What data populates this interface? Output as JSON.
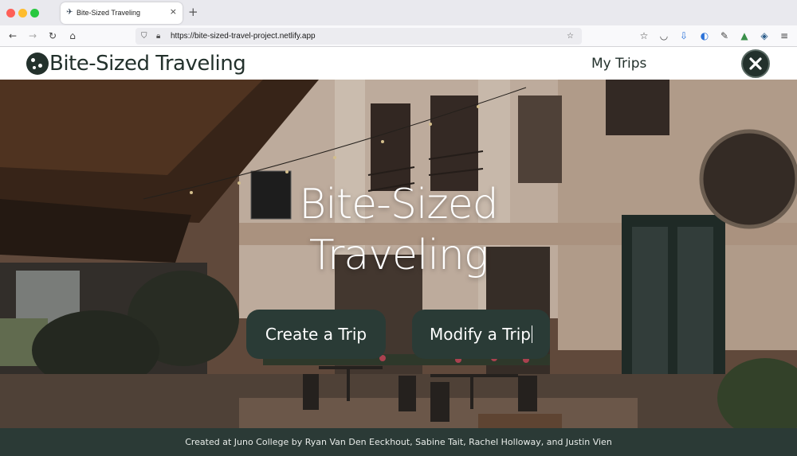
{
  "browser": {
    "tab": {
      "title": "Bite-Sized Traveling",
      "favicon": "airplane-icon",
      "close": "×"
    },
    "new_tab": "+",
    "url": "https://bite-sized-travel-project.netlify.app",
    "toolbar_icons": [
      "back-icon",
      "forward-icon",
      "reload-icon",
      "home-icon",
      "shield-icon",
      "lock-icon",
      "star-icon",
      "library-icon",
      "pocket-icon",
      "downloads-icon",
      "extension-icon",
      "eyedropper-icon",
      "extension-icon",
      "extension-icon",
      "menu-icon"
    ]
  },
  "header": {
    "brand": "Bite-Sized Traveling",
    "nav": {
      "my_trips": "My Trips"
    },
    "close_label": "✕"
  },
  "hero": {
    "title_line1": "Bite-Sized",
    "title_line2": "Traveling",
    "create_button": "Create a Trip",
    "modify_button": "Modify a Trip"
  },
  "footer": {
    "credits": "Created at Juno College by Ryan Van Den Eeckhout, Sabine Tait, Rachel Holloway, and Justin Vien"
  },
  "colors": {
    "brand_dark": "#23312c",
    "button_bg": "#2a3b36",
    "footer_bg": "#2b3a36"
  }
}
